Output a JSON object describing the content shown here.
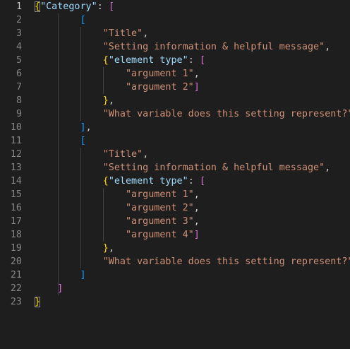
{
  "editor": {
    "line_numbers": [
      "1",
      "2",
      "3",
      "4",
      "5",
      "6",
      "7",
      "8",
      "9",
      "10",
      "11",
      "12",
      "13",
      "14",
      "15",
      "16",
      "17",
      "18",
      "19",
      "20",
      "21",
      "22",
      "23"
    ],
    "tokens": {
      "open_brace": "{",
      "close_brace": "}",
      "open_bracket": "[",
      "close_bracket": "]",
      "colon_space": ": ",
      "comma": ",",
      "key_category": "\"Category\"",
      "key_element_type": "\"element type\"",
      "title": "\"Title\"",
      "setting_info": "\"Setting information & helpful message\"",
      "arg1": "\"argument 1\"",
      "arg2": "\"argument 2\"",
      "arg3": "\"argument 3\"",
      "arg4": "\"argument 4\"",
      "variable_question": "\"What variable does this setting represent?\""
    }
  }
}
